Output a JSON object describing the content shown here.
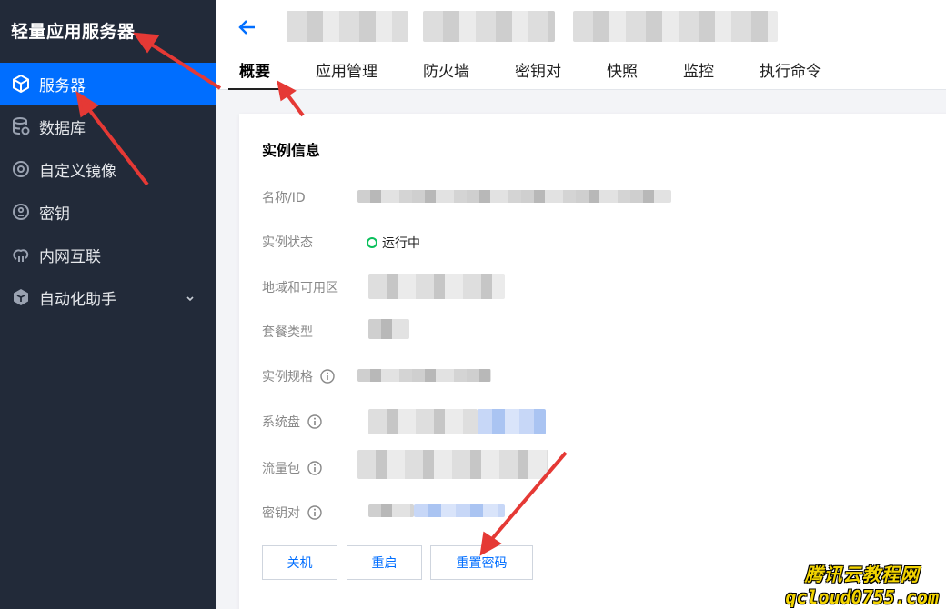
{
  "sidebar": {
    "title": "轻量应用服务器",
    "items": [
      {
        "label": "服务器",
        "icon": "cube-icon",
        "active": true
      },
      {
        "label": "数据库",
        "icon": "database-icon"
      },
      {
        "label": "自定义镜像",
        "icon": "disc-icon"
      },
      {
        "label": "密钥",
        "icon": "key-icon"
      },
      {
        "label": "内网互联",
        "icon": "network-icon"
      },
      {
        "label": "自动化助手",
        "icon": "automation-icon",
        "has_submenu": true
      }
    ]
  },
  "header": {
    "tabs": [
      {
        "label": "概要",
        "active": true
      },
      {
        "label": "应用管理"
      },
      {
        "label": "防火墙"
      },
      {
        "label": "密钥对"
      },
      {
        "label": "快照"
      },
      {
        "label": "监控"
      },
      {
        "label": "执行命令"
      }
    ]
  },
  "instance": {
    "section_title": "实例信息",
    "labels": {
      "name": "名称/ID",
      "status": "实例状态",
      "region": "地域和可用区",
      "plan": "套餐类型",
      "spec": "实例规格",
      "disk": "系统盘",
      "traffic": "流量包",
      "keypair": "密钥对"
    },
    "status_value": "运行中",
    "status_color": "#0abf5b"
  },
  "actions": {
    "shutdown": "关机",
    "restart": "重启",
    "reset_password": "重置密码"
  },
  "watermark": {
    "line1": "腾讯云教程网",
    "line2": "qcloud0755.com"
  },
  "colors": {
    "sidebar_bg": "#222a39",
    "accent": "#006eff",
    "annotation_arrow": "#e53935"
  }
}
